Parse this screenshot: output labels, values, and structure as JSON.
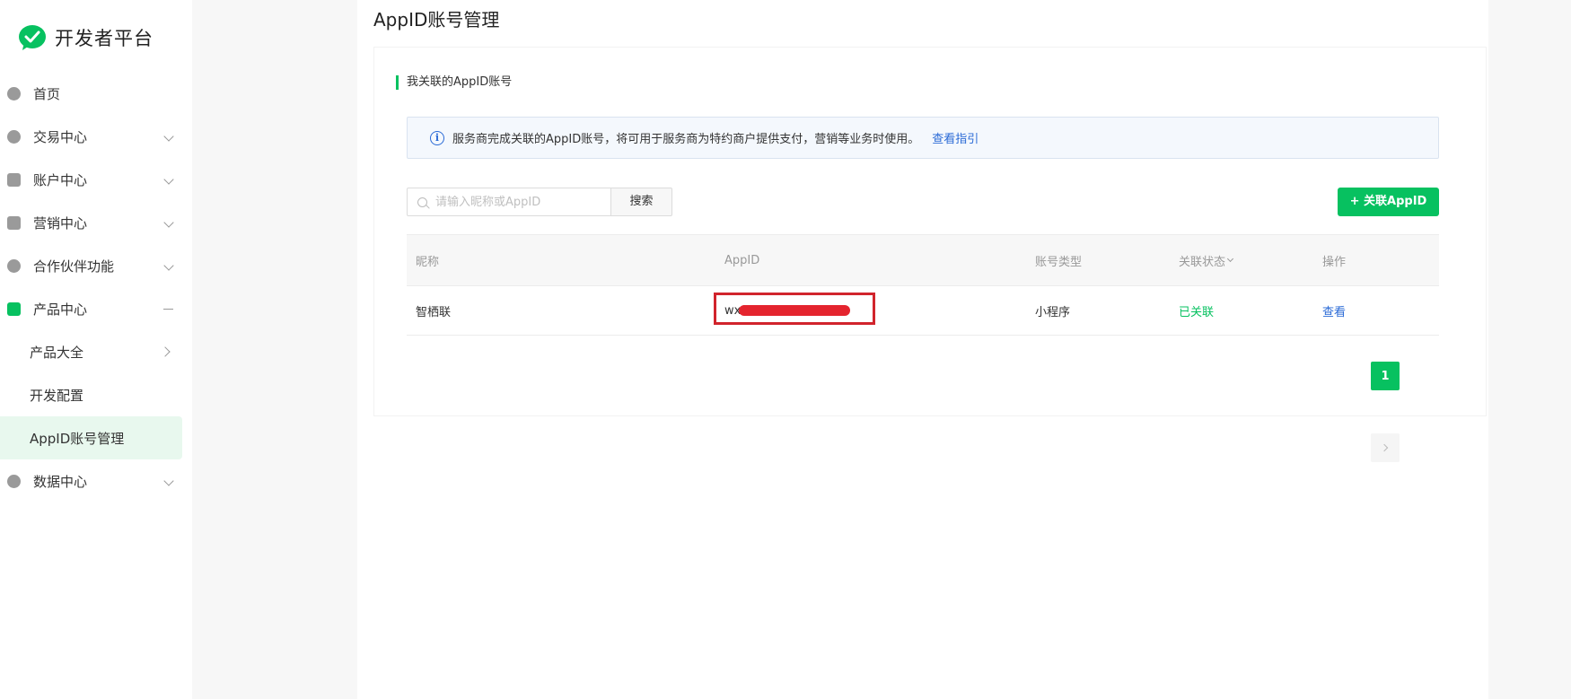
{
  "brand": {
    "name": "开发者平台"
  },
  "sidebar": {
    "items": [
      {
        "label": "首页"
      },
      {
        "label": "交易中心"
      },
      {
        "label": "账户中心"
      },
      {
        "label": "营销中心"
      },
      {
        "label": "合作伙伴功能"
      },
      {
        "label": "产品中心"
      },
      {
        "label": "产品大全"
      },
      {
        "label": "开发配置"
      },
      {
        "label": "AppID账号管理"
      },
      {
        "label": "数据中心"
      }
    ]
  },
  "page": {
    "title": "AppID账号管理"
  },
  "section": {
    "title": "我关联的AppID账号"
  },
  "notice": {
    "text": "服务商完成关联的AppID账号，将可用于服务商为特约商户提供支付，营销等业务时使用。",
    "link": "查看指引"
  },
  "search": {
    "placeholder": "请输入昵称或AppID",
    "button": "搜索"
  },
  "add_button": "+ 关联AppID",
  "table": {
    "headers": [
      "昵称",
      "AppID",
      "账号类型",
      "关联状态",
      "操作"
    ],
    "rows": [
      {
        "nickname": "智栖联",
        "appid": "wx9",
        "type": "小程序",
        "status": "已关联",
        "action": "查看"
      }
    ]
  },
  "pagination": {
    "current": "1"
  },
  "colors": {
    "accent": "#07c160",
    "link": "#2a6ad6",
    "highlight": "#d1242c"
  }
}
